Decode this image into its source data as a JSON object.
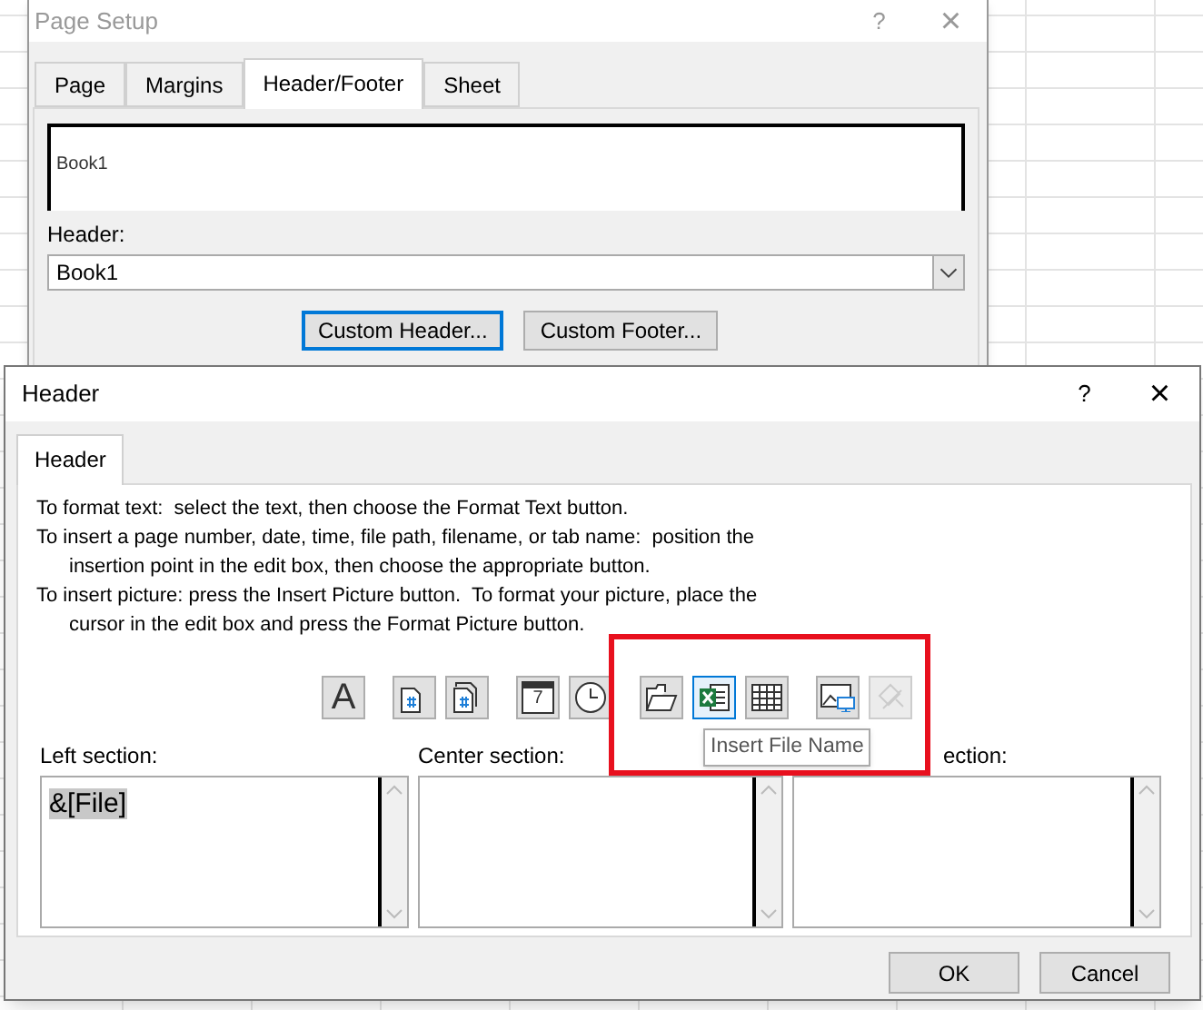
{
  "page_setup": {
    "title": "Page Setup",
    "help": "?",
    "close": "×",
    "tabs": [
      {
        "label": "Page",
        "selected": false
      },
      {
        "label": "Margins",
        "selected": false
      },
      {
        "label": "Header/Footer",
        "selected": true
      },
      {
        "label": "Sheet",
        "selected": false
      }
    ],
    "preview_text": "Book1",
    "header_label": "Header:",
    "header_value": "Book1",
    "buttons": [
      {
        "label": "Custom Header...",
        "selected": true
      },
      {
        "label": "Custom Footer...",
        "selected": false
      }
    ]
  },
  "header_dialog": {
    "title": "Header",
    "help": "?",
    "close": "×",
    "tabs": [
      {
        "label": "Header",
        "selected": true
      }
    ],
    "instructions": [
      {
        "lines": [
          "To format text:  select the text, then choose the Format Text button."
        ]
      },
      {
        "lines": [
          "To insert a page number, date, time, file path, filename, or tab name:  position the",
          "insertion point in the edit box, then choose the appropriate button."
        ]
      },
      {
        "lines": [
          "To insert picture: press the Insert Picture button.  To format your picture, place the",
          "cursor in the edit box and press the Format Picture button."
        ]
      }
    ],
    "toolbar_groups": [
      [
        {
          "kind": "format-text",
          "selected": false,
          "disabled": false,
          "glyph": "A"
        }
      ],
      [
        {
          "kind": "page-number",
          "selected": false,
          "disabled": false
        },
        {
          "kind": "pages",
          "selected": false,
          "disabled": false
        }
      ],
      [
        {
          "kind": "date",
          "selected": false,
          "disabled": false,
          "glyph": "7"
        },
        {
          "kind": "time",
          "selected": false,
          "disabled": false
        }
      ],
      [
        {
          "kind": "path",
          "selected": false,
          "disabled": false
        },
        {
          "kind": "file",
          "selected": true,
          "disabled": false
        },
        {
          "kind": "sheet",
          "selected": false,
          "disabled": false
        }
      ],
      [
        {
          "kind": "picture",
          "selected": false,
          "disabled": false
        },
        {
          "kind": "format-picture",
          "selected": false,
          "disabled": true
        }
      ]
    ],
    "sections": [
      {
        "label": "Left section:",
        "value": "&[File]"
      },
      {
        "label": "Center section:"
      },
      {
        "label": "ection:"
      }
    ],
    "tooltip": "Insert File Name",
    "buttons": [
      "OK",
      "Cancel"
    ]
  }
}
